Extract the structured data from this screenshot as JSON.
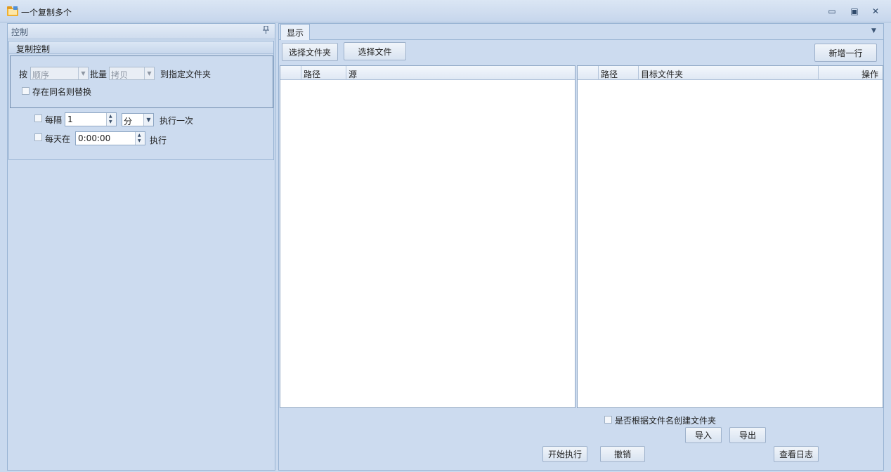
{
  "window": {
    "title": "一个复制多个",
    "minimize_glyph": "▭",
    "maximize_glyph": "▣",
    "close_glyph": "✕"
  },
  "left_panel": {
    "title": "控制",
    "pin_glyph": "ꟷ",
    "group_title": "复制控制",
    "by_label": "按",
    "order_combo": "顺序",
    "batch_label": "批量",
    "copy_combo": "拷贝",
    "target_label": "到指定文件夹",
    "replace_checkbox_label": "存在同名则替换",
    "interval_checkbox_label": "每隔",
    "interval_value": "1",
    "interval_unit": "分",
    "interval_suffix": "执行一次",
    "daily_checkbox_label": "每天在",
    "daily_time": "0:00:00",
    "daily_suffix": "执行"
  },
  "right_panel": {
    "tab_label": "显示",
    "select_folder_button": "选择文件夹",
    "select_file_button": "选择文件",
    "add_row_button": "新增一行",
    "source_grid": {
      "columns": [
        "路径",
        "源"
      ]
    },
    "target_grid": {
      "columns": [
        "路径",
        "目标文件夹",
        "操作"
      ]
    },
    "create_folder_checkbox_label": "是否根据文件名创建文件夹",
    "import_button": "导入",
    "export_button": "导出",
    "start_button": "开始执行",
    "cancel_button": "撤销",
    "view_log_button": "查看日志"
  },
  "colors": {
    "background": "#c9d9ee",
    "panel_border": "#98b3d3",
    "grid_background": "#ffffff"
  },
  "icons": [
    "app-folder-icon",
    "minimize-icon",
    "maximize-icon",
    "close-icon",
    "pin-icon",
    "dropdown-arrow-icon",
    "spin-up-icon",
    "spin-down-icon"
  ]
}
